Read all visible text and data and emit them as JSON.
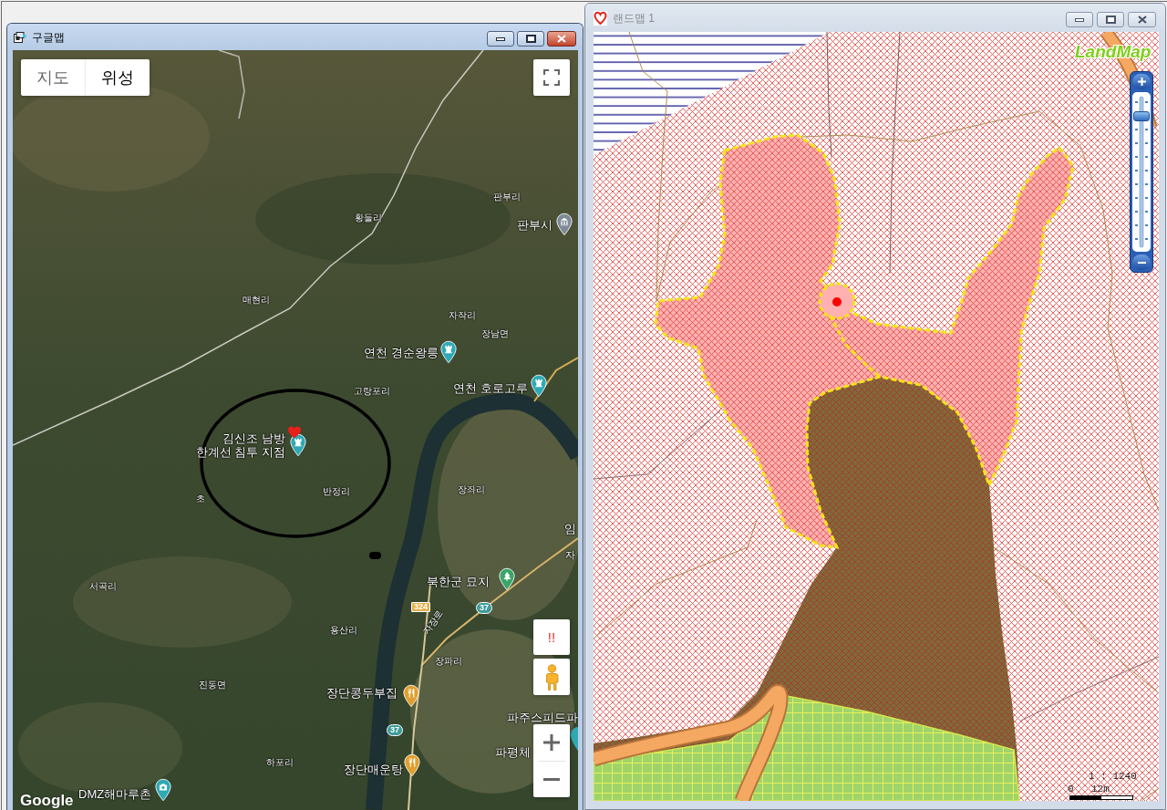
{
  "google_map_window": {
    "title": "구글맵",
    "active": true,
    "map_type_tabs": [
      {
        "label": "지도",
        "selected": false
      },
      {
        "label": "위성",
        "selected": true
      }
    ],
    "place_labels": [
      "판부리",
      "황둘리",
      "매현리",
      "자작리",
      "장남면",
      "고랑포리",
      "초",
      "반정리",
      "장좌리",
      "서곡리",
      "용산리",
      "장파리",
      "진동면",
      "하포리"
    ],
    "pois": [
      {
        "kind": "museum",
        "text": "판부시"
      },
      {
        "kind": "landmark",
        "text": "연천 경순왕릉"
      },
      {
        "kind": "landmark",
        "text": "연천 호로고루"
      },
      {
        "kind": "landmark",
        "lines": [
          "김신조 남방",
          "한계선 침투 지점"
        ]
      },
      {
        "kind": "plain",
        "text": "임"
      },
      {
        "kind": "plain",
        "text": "자"
      },
      {
        "kind": "cemetery",
        "text": "북한군 묘지"
      },
      {
        "kind": "restaurant",
        "text": "장단콩두부집"
      },
      {
        "kind": "plain",
        "text": "파주스피드파"
      },
      {
        "kind": "plain",
        "text": "파평체"
      },
      {
        "kind": "restaurant",
        "text": "장단매운탕"
      },
      {
        "kind": "photo",
        "text": "DMZ해마루촌"
      }
    ],
    "route_shields": [
      {
        "kind": "local_road",
        "text": "324"
      },
      {
        "kind": "national_road",
        "text": "37"
      },
      {
        "kind": "national_road",
        "text": "37"
      }
    ],
    "road_labels": [
      "자장로"
    ],
    "alert_button": "!!",
    "logo": "Google"
  },
  "landmap_window": {
    "title": "랜드맵 1",
    "active": false,
    "logo": "LandMap",
    "zoom_slider": {
      "level": 0.87
    },
    "scale": {
      "ratio": "1 : 1240",
      "start": "0",
      "end": "12m"
    }
  }
}
